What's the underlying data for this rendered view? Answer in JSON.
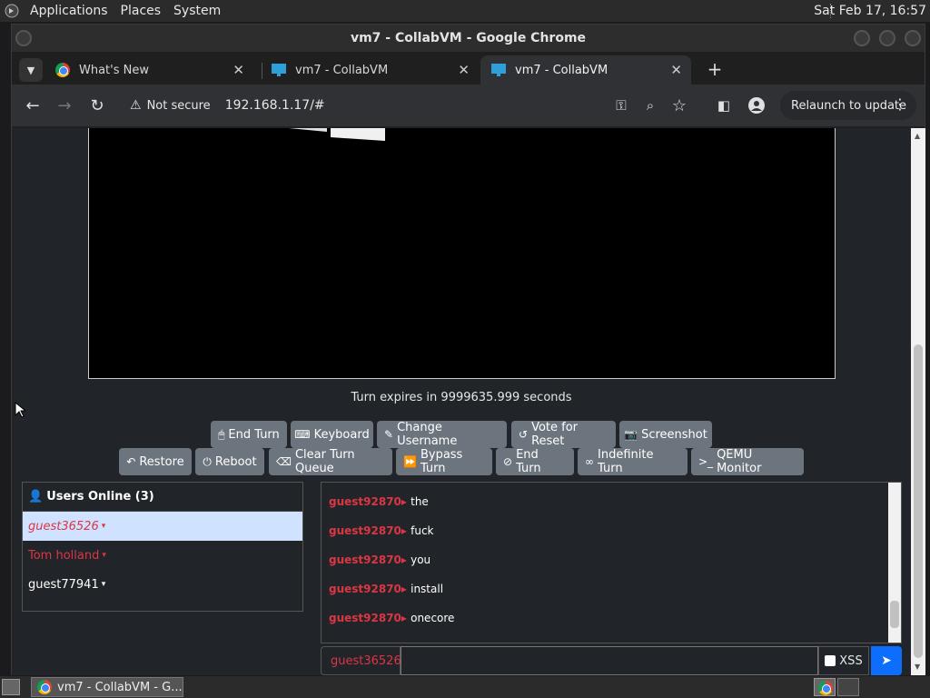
{
  "top_panel": {
    "menus": [
      "Applications",
      "Places",
      "System"
    ],
    "clock": "Sat Feb 17, 16:57"
  },
  "window": {
    "title": "vm7 - CollabVM - Google Chrome"
  },
  "tabs": [
    {
      "label": "What's New",
      "favicon": "chrome-icon",
      "active": false
    },
    {
      "label": "vm7 - CollabVM",
      "favicon": "monitor-icon",
      "active": false
    },
    {
      "label": "vm7 - CollabVM",
      "favicon": "monitor-icon",
      "active": true
    }
  ],
  "toolbar": {
    "security": "Not secure",
    "url": "192.168.1.17/#",
    "relaunch": "Relaunch to update"
  },
  "vm": {
    "turn_text": "Turn expires in 9999635.999 seconds",
    "buttons_row1": [
      {
        "label": "End Turn",
        "icon": "mouse-icon"
      },
      {
        "label": "Keyboard",
        "icon": "keyboard-icon"
      },
      {
        "label": "Change Username",
        "icon": "user-edit-icon"
      },
      {
        "label": "Vote for Reset",
        "icon": "reset-icon"
      },
      {
        "label": "Screenshot",
        "icon": "camera-icon"
      }
    ],
    "buttons_row2": [
      {
        "label": "Restore",
        "icon": "restore-icon"
      },
      {
        "label": "Reboot",
        "icon": "power-icon"
      },
      {
        "label": "Clear Turn Queue",
        "icon": "eraser-icon"
      },
      {
        "label": "Bypass Turn",
        "icon": "fast-forward-icon"
      },
      {
        "label": "End Turn",
        "icon": "ban-icon"
      },
      {
        "label": "Indefinite Turn",
        "icon": "infinity-icon"
      },
      {
        "label": "QEMU Monitor",
        "icon": "terminal-icon"
      }
    ]
  },
  "users": {
    "header": "Users Online (3)",
    "list": [
      {
        "name": "guest36526",
        "color": "#dc3545",
        "highlight": true
      },
      {
        "name": "Tom holland",
        "color": "#dc3545",
        "highlight": false
      },
      {
        "name": "guest77941",
        "color": "#ffffff",
        "highlight": false
      }
    ]
  },
  "chat": {
    "messages": [
      {
        "nick": "guest92870",
        "text": "the"
      },
      {
        "nick": "guest92870",
        "text": "fuck"
      },
      {
        "nick": "guest92870",
        "text": "you"
      },
      {
        "nick": "guest92870",
        "text": "install"
      },
      {
        "nick": "guest92870",
        "text": "onecore"
      }
    ],
    "nick_label": "guest36526",
    "xss_label": "XSS"
  },
  "taskbar": {
    "task_label": "vm7 - CollabVM - G..."
  }
}
